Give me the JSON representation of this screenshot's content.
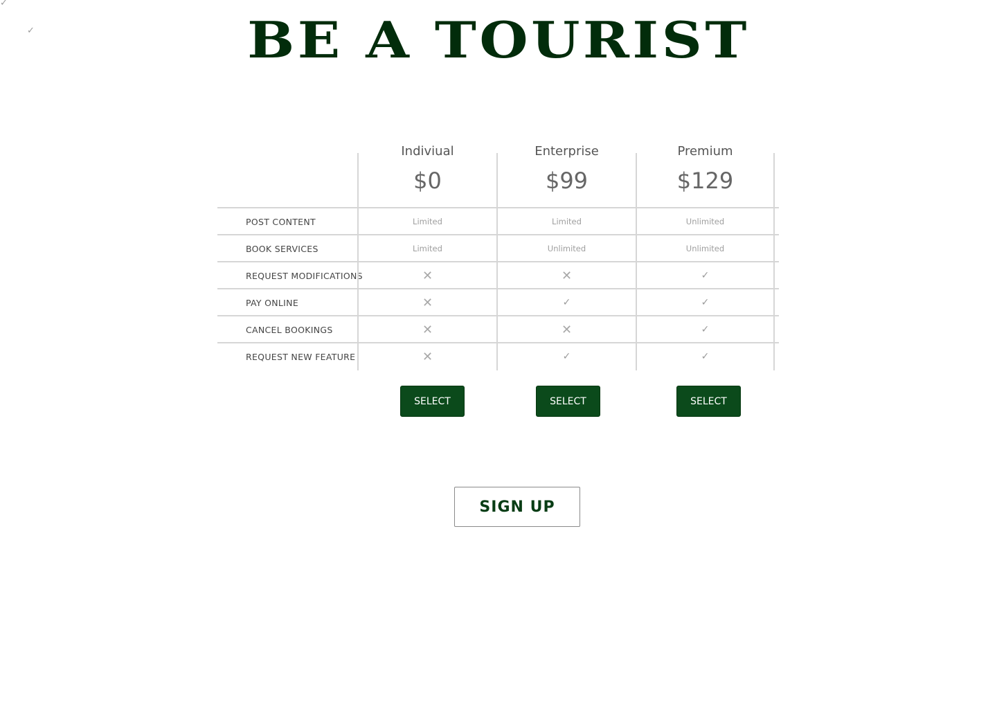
{
  "stray_marks": [
    "✓",
    "✓"
  ],
  "brand": {
    "title": "BE A TOURIST",
    "color": "#022c0b"
  },
  "plans": [
    {
      "name": "Indiviual",
      "price": "$0",
      "select_label": "SELECT"
    },
    {
      "name": "Enterprise",
      "price": "$99",
      "select_label": "SELECT"
    },
    {
      "name": "Premium",
      "price": "$129",
      "select_label": "SELECT"
    }
  ],
  "features": [
    {
      "label": "POST CONTENT",
      "values": [
        "Limited",
        "Limited",
        "Unlimited"
      ]
    },
    {
      "label": "BOOK SERVICES",
      "values": [
        "Limited",
        "Unlimited",
        "Unlimited"
      ]
    },
    {
      "label": "REQUEST MODIFICATIONS",
      "values": [
        "✕",
        "✕",
        "✓"
      ]
    },
    {
      "label": "PAY ONLINE",
      "values": [
        "✕",
        "✓",
        "✓"
      ]
    },
    {
      "label": "CANCEL BOOKINGS",
      "values": [
        "✕",
        "✕",
        "✓"
      ]
    },
    {
      "label": "REQUEST NEW FEATURE",
      "values": [
        "✕",
        "✓",
        "✓"
      ]
    }
  ],
  "icons": {
    "yes": "check-icon",
    "no": "cross-icon"
  },
  "accent_color": "#0b4a1b",
  "signup": {
    "label": "SIGN UP"
  }
}
